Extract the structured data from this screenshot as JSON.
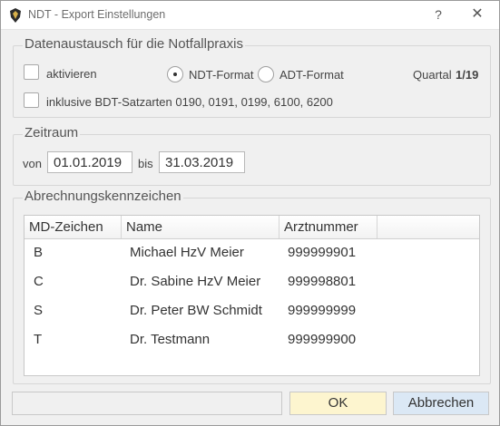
{
  "window": {
    "title": "NDT - Export Einstellungen",
    "help_label": "?",
    "close_label": "✕"
  },
  "datenaustausch": {
    "legend": "Datenaustausch für die Notfallpraxis",
    "activate_label": "aktivieren",
    "activate_checked": false,
    "format_options": [
      "NDT-Format",
      "ADT-Format"
    ],
    "selected_format": "NDT-Format",
    "quarter_label": "Quartal",
    "quarter_value": "1/19",
    "include_label": "inklusive BDT-Satzarten 0190, 0191, 0199, 6100, 6200",
    "include_checked": false
  },
  "zeitraum": {
    "legend": "Zeitraum",
    "from_label": "von",
    "from_value": "01.01.2019",
    "to_label": "bis",
    "to_value": "31.03.2019"
  },
  "abrechnung": {
    "legend": "Abrechnungskennzeichen",
    "columns": [
      "MD-Zeichen",
      "Name",
      "Arztnummer"
    ],
    "rows": [
      {
        "code": "B",
        "name": "Michael HzV Meier",
        "number": "999999901"
      },
      {
        "code": "C",
        "name": "Dr. Sabine HzV Meier",
        "number": "999998801"
      },
      {
        "code": "S",
        "name": "Dr. Peter BW Schmidt",
        "number": "999999999"
      },
      {
        "code": "T",
        "name": "Dr. Testmann",
        "number": "999999900"
      }
    ]
  },
  "buttons": {
    "ok": "OK",
    "cancel": "Abbrechen"
  },
  "colors": {
    "ok_button": "#fdf5cf",
    "cancel_button": "#dbe8f5"
  }
}
